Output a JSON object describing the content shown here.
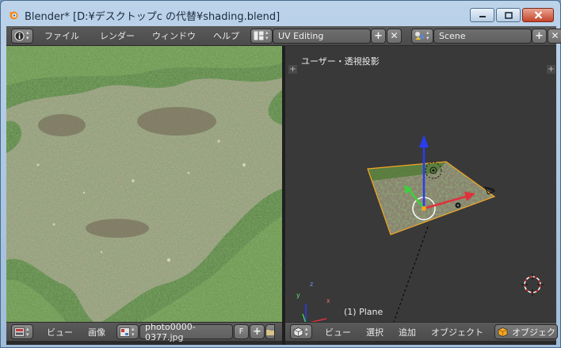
{
  "window": {
    "title": "Blender* [D:¥デスクトップc の代替¥shading.blend]",
    "icons": {
      "app": "blender-logo-icon",
      "minimize": "minimize-icon",
      "maximize": "maximize-icon",
      "close": "close-icon"
    }
  },
  "top_header": {
    "editor_icon": "info-icon",
    "menus": [
      "ファイル",
      "レンダー",
      "ウィンドウ",
      "ヘルプ"
    ],
    "layout_icon": "screen-layout-icon",
    "layout_name": "UV Editing",
    "scene_icon": "scene-icon",
    "scene_name": "Scene",
    "add_label": "+",
    "remove_label": "✕"
  },
  "uv_header": {
    "editor_icon": "image-editor-icon",
    "menus": [
      "ビュー",
      "画像"
    ],
    "image_browse_icon": "image-browse-icon",
    "image_name": "photo0000-0377.jpg",
    "fake_user_label": "F",
    "add_label": "+",
    "folder_icon": "open-folder-icon"
  },
  "viewport_header": {
    "editor_icon": "3d-view-icon",
    "menus": [
      "ビュー",
      "選択",
      "追加",
      "オブジェクト"
    ],
    "mode_icon": "object-mode-icon",
    "mode_label": "オブジェクト"
  },
  "viewport": {
    "view_label": "ユーザー・透視投影",
    "object_label": "(1) Plane",
    "axis_labels": {
      "x": "x",
      "y": "y",
      "z": "z"
    },
    "colors": {
      "x_axis": "#e0303a",
      "y_axis": "#3ad13a",
      "z_axis": "#2a3cf0",
      "selection": "#f5a623"
    }
  }
}
